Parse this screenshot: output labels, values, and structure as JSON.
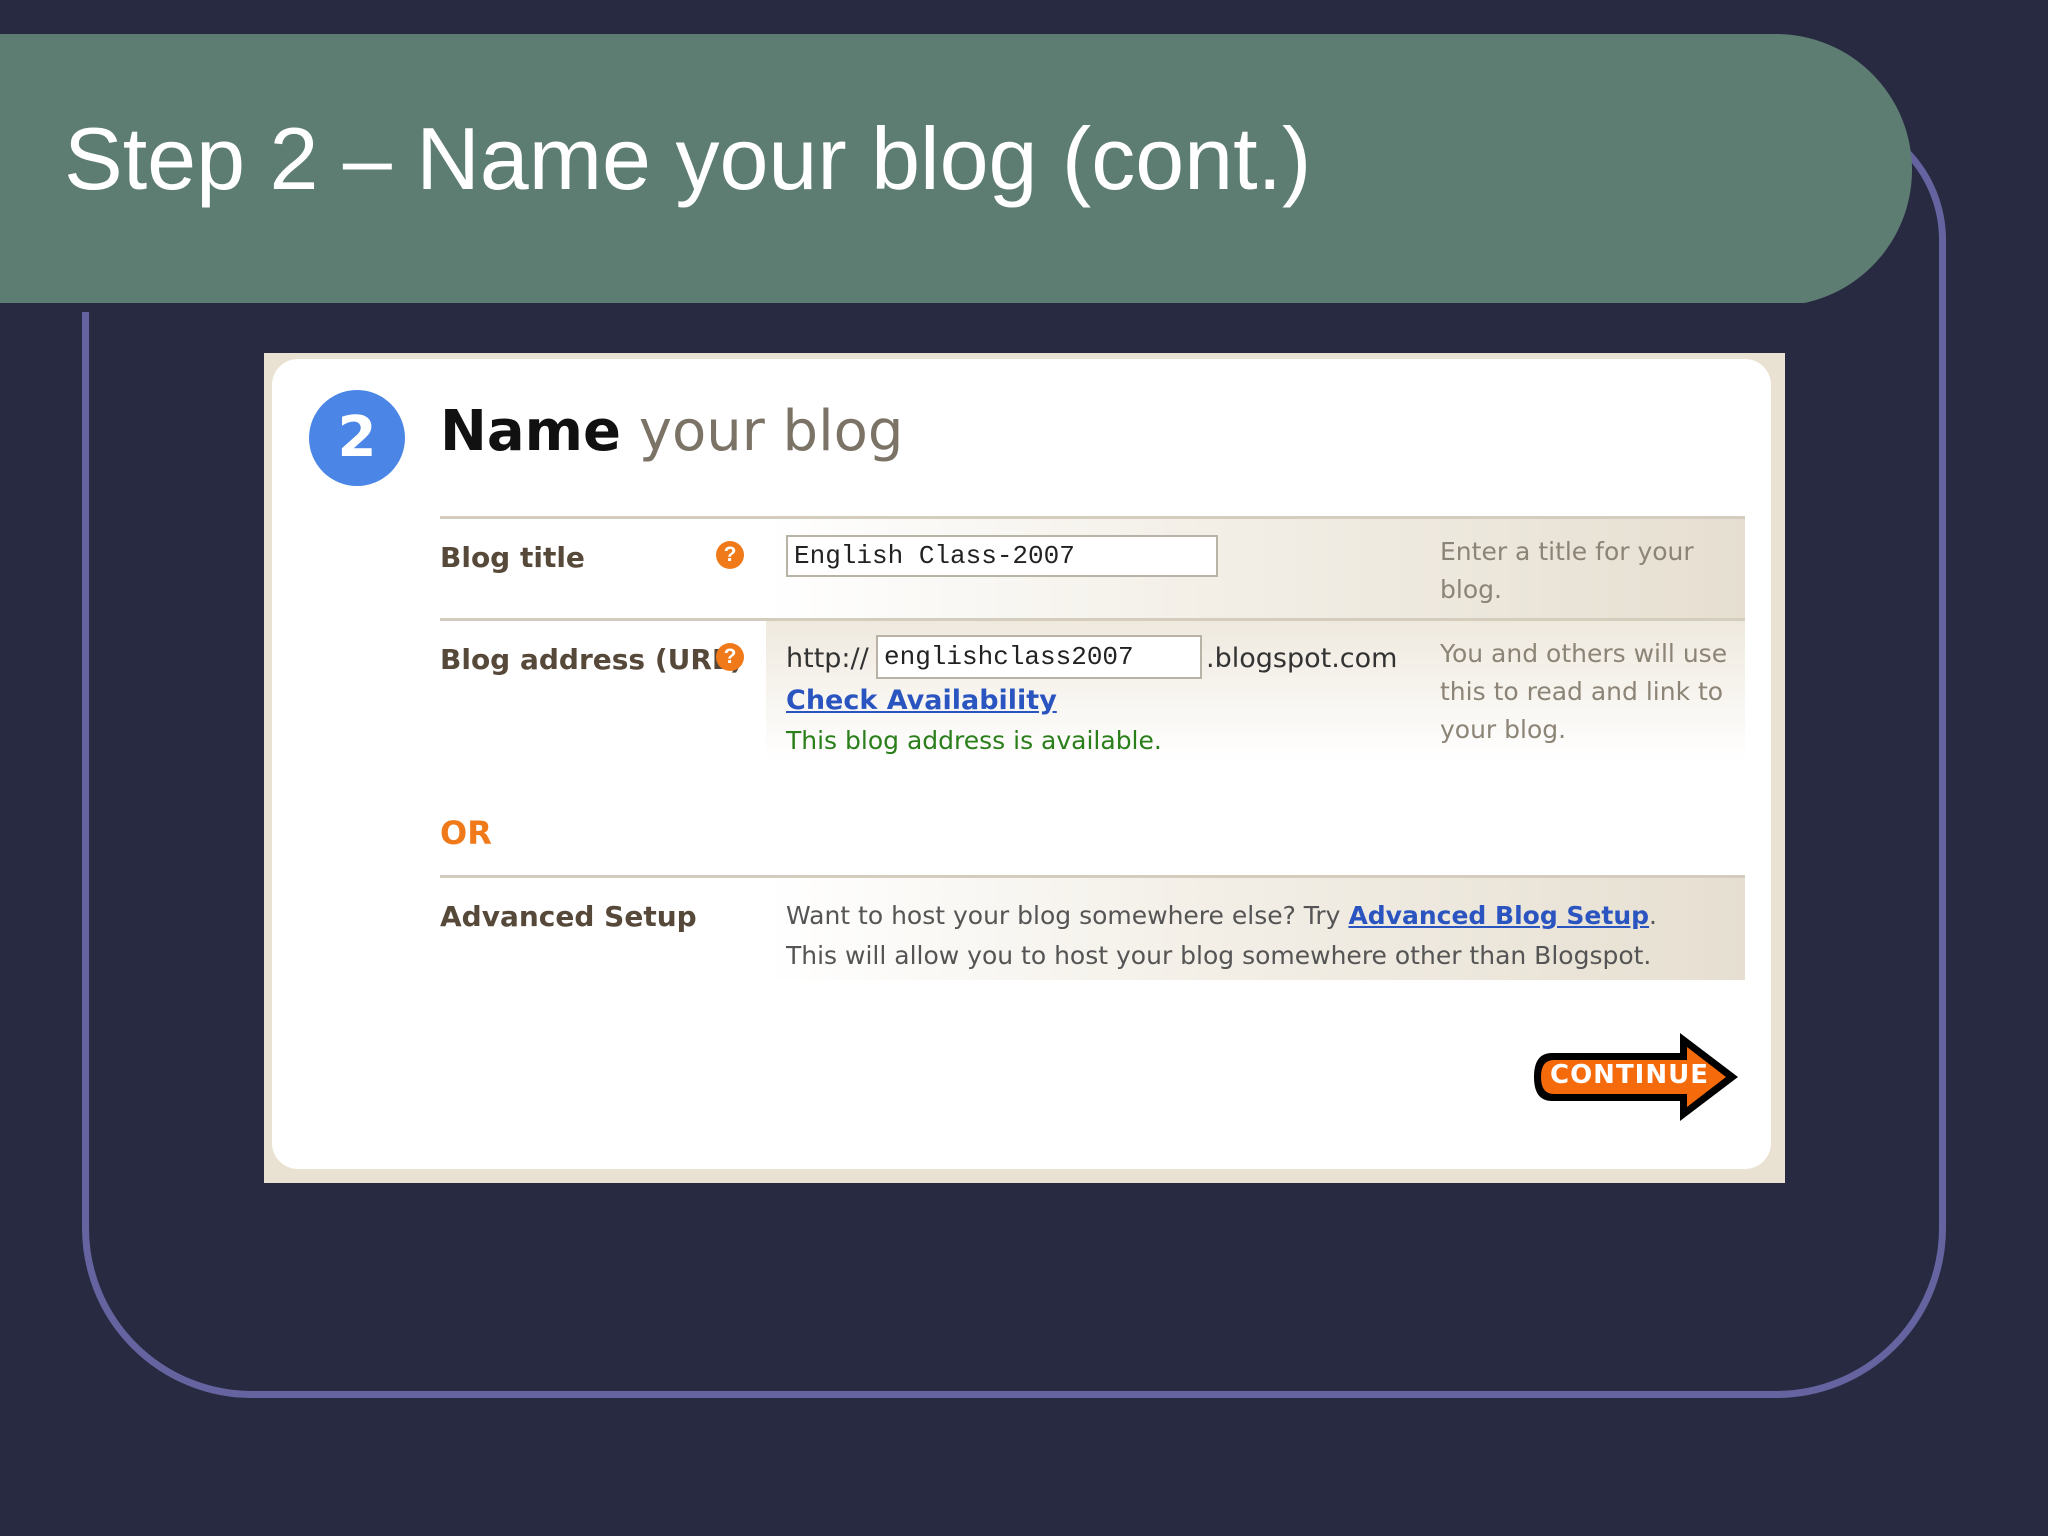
{
  "slide": {
    "title": "Step 2 – Name your blog (cont.)"
  },
  "screenshot": {
    "step_number": "2",
    "heading_strong": "Name",
    "heading_soft": "your blog",
    "blog_title": {
      "label": "Blog title",
      "help": "?",
      "value": "English Class-2007",
      "hint": "Enter a title for your blog."
    },
    "blog_address": {
      "label": "Blog address (URL)",
      "help": "?",
      "prefix": "http://",
      "value": "englishclass2007",
      "suffix": ".blogspot.com",
      "check_link": "Check Availability",
      "status": "This blog address is available.",
      "hint": "You and others will use this to read and link to your blog."
    },
    "or_label": "OR",
    "advanced": {
      "label": "Advanced Setup",
      "text_before": "Want to host your blog somewhere else? Try ",
      "link": "Advanced Blog Setup",
      "text_after": ". This will allow you to host your blog somewhere other than Blogspot."
    },
    "continue_label": "CONTINUE"
  },
  "colors": {
    "background": "#282a41",
    "title_bar": "#5e7d72",
    "frame": "#6664a0",
    "accent_orange": "#f07a1a",
    "step_blue": "#4b86e6",
    "link_blue": "#2a55c0",
    "status_green": "#2a7f1a"
  }
}
